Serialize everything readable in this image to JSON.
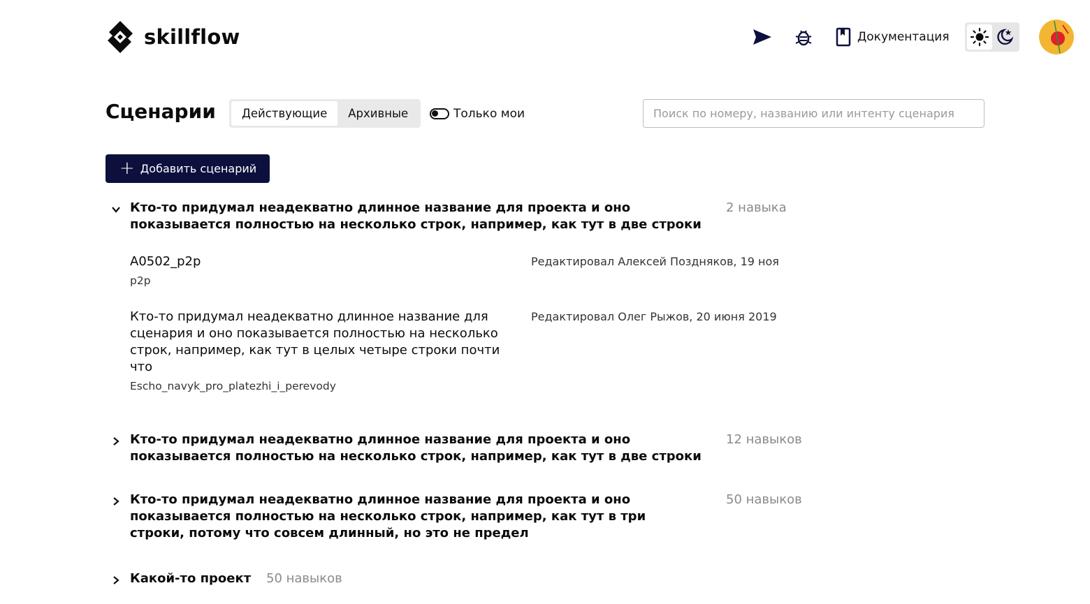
{
  "header": {
    "logo_text": "skillflow",
    "docs_label": "Документация",
    "icons": {
      "send": "send-icon",
      "bug": "bug-icon",
      "docs": "book-icon",
      "light": "sun-icon",
      "dark": "moon-icon"
    },
    "colors": {
      "brand": "#0d0f3d",
      "avatar_bg": "#f2b632",
      "avatar_accent": "#e0202a"
    }
  },
  "page": {
    "title": "Сценарии",
    "tabs": [
      {
        "label": "Действующие",
        "active": true
      },
      {
        "label": "Архивные",
        "active": false
      }
    ],
    "only_mine_label": "Только мои",
    "search_placeholder": "Поиск по номеру, названию или интенту сценария",
    "search_value": "",
    "add_button_label": "Добавить сценарий"
  },
  "projects": [
    {
      "title": "Кто-то придумал неадекватно длинное название для проекта и оно показывается полностью на несколько строк, например, как тут в две строки",
      "count": "2 навыка",
      "expanded": true,
      "scenarios": [
        {
          "title": "A0502_p2p",
          "intent": "p2p",
          "meta": "Редактировал Алексей Поздняков, 19 ноя"
        },
        {
          "title": "Кто-то придумал неадекватно длинное название для сценария и оно показывается полностью на несколько строк, например, как тут в целых четыре строки почти что",
          "intent": "Escho_navyk_pro_platezhi_i_perevody",
          "meta": "Редактировал Олег Рыжов, 20 июня 2019"
        }
      ]
    },
    {
      "title": "Кто-то придумал неадекватно длинное название для проекта и оно показывается полностью на несколько строк, например, как тут в две строки",
      "count": "12 навыков",
      "expanded": false
    },
    {
      "title": "Кто-то придумал неадекватно длинное название для проекта и оно показывается полностью на несколько строк, например, как тут в три строки, потому что совсем длинный, но это не предел",
      "count": "50 навыков",
      "expanded": false
    },
    {
      "title": "Какой-то проект",
      "count": "50 навыков",
      "expanded": false
    }
  ]
}
